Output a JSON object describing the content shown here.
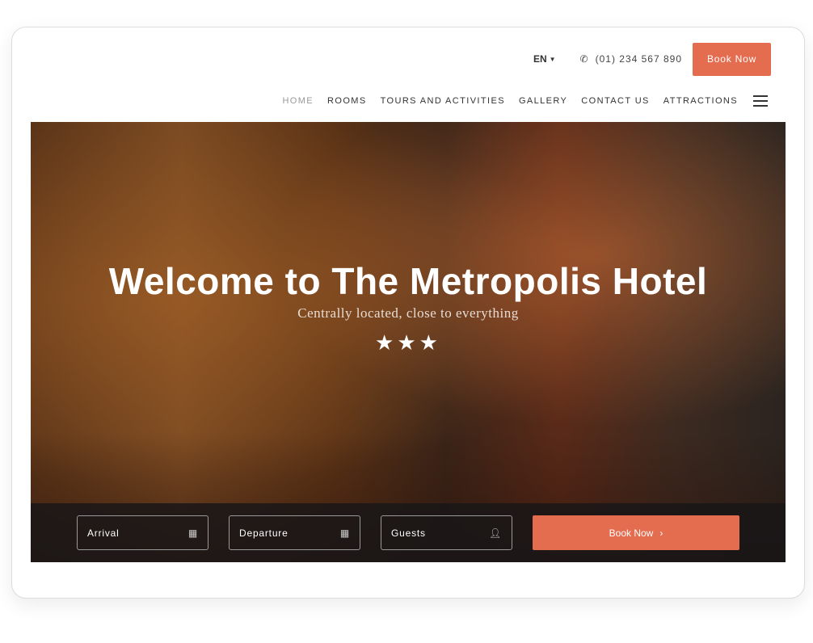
{
  "header": {
    "language": "EN",
    "phone": "(01) 234 567 890",
    "book_label": "Book Now"
  },
  "nav": {
    "items": [
      "HOME",
      "ROOMS",
      "TOURS AND ACTIVITIES",
      "GALLERY",
      "CONTACT US",
      "ATTRACTIONS"
    ],
    "active": "HOME"
  },
  "hero": {
    "title": "Welcome to The Metropolis Hotel",
    "subtitle": "Centrally located, close to everything",
    "stars": 3
  },
  "booking": {
    "arrival_placeholder": "Arrival",
    "departure_placeholder": "Departure",
    "guests_placeholder": "Guests",
    "submit_label": "Book Now",
    "submit_arrow": "›"
  },
  "colors": {
    "accent": "#e46c4f"
  }
}
